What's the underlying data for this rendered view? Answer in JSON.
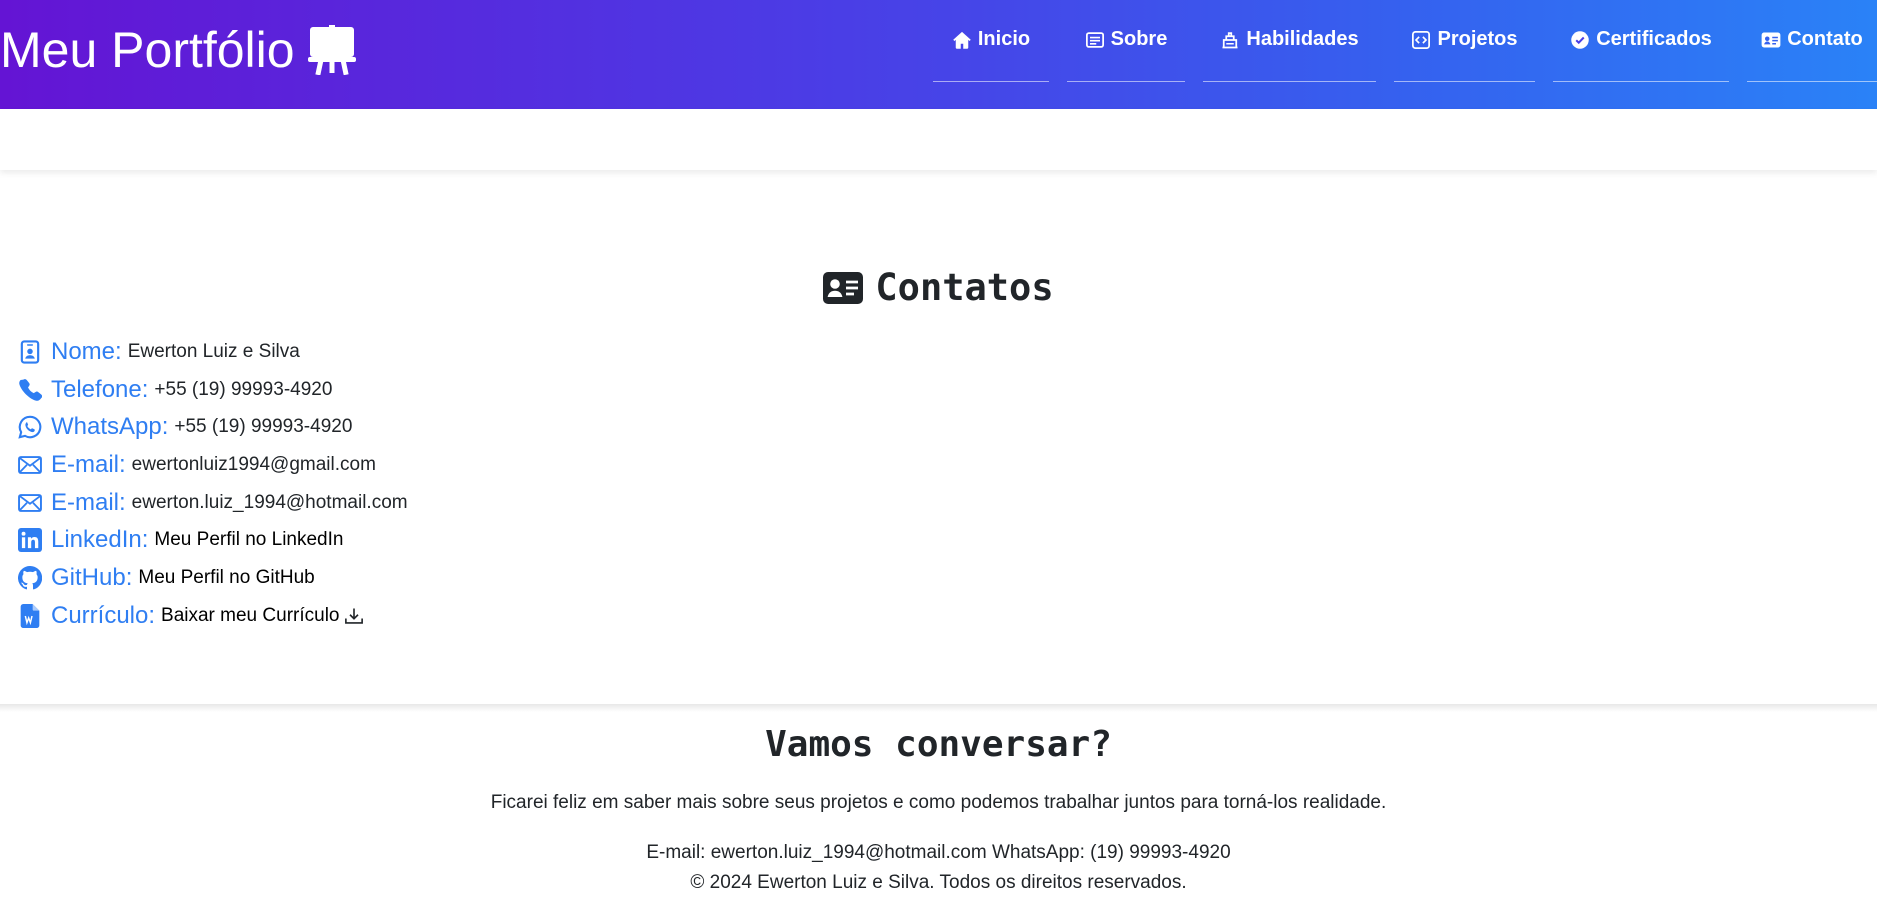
{
  "header": {
    "brand": "Meu Portfólio",
    "brand_icon": "easel-icon",
    "nav": [
      {
        "label": "Inicio",
        "icon": "house-icon"
      },
      {
        "label": "Sobre",
        "icon": "file-text-icon"
      },
      {
        "label": "Habilidades",
        "icon": "building-icon"
      },
      {
        "label": "Projetos",
        "icon": "code-square-icon"
      },
      {
        "label": "Certificados",
        "icon": "patch-check-icon"
      },
      {
        "label": "Contato",
        "icon": "person-vcard-icon"
      }
    ]
  },
  "contatos": {
    "title": "Contatos",
    "title_icon": "person-vcard-icon",
    "items": [
      {
        "label": "Nome:",
        "value": "Ewerton Luiz e Silva",
        "icon": "person-badge-icon"
      },
      {
        "label": "Telefone:",
        "value": "+55 (19) 99993-4920",
        "icon": "telephone-icon"
      },
      {
        "label": "WhatsApp:",
        "value": "+55 (19) 99993-4920",
        "icon": "whatsapp-icon"
      },
      {
        "label": "E-mail:",
        "value": "ewertonluiz1994@gmail.com",
        "icon": "envelope-icon"
      },
      {
        "label": "E-mail:",
        "value": "ewerton.luiz_1994@hotmail.com",
        "icon": "envelope-icon"
      },
      {
        "label": "LinkedIn:",
        "value": "Meu Perfil no LinkedIn",
        "icon": "linkedin-icon"
      },
      {
        "label": "GitHub:",
        "value": "Meu Perfil no GitHub",
        "icon": "github-icon"
      },
      {
        "label": "Currículo:",
        "value": "Baixar meu Currículo",
        "icon": "file-word-icon"
      }
    ]
  },
  "footer": {
    "title": "Vamos conversar?",
    "text": "Ficarei feliz em saber mais sobre seus projetos e como podemos trabalhar juntos para torná-los realidade.",
    "contact": "E-mail: ewerton.luiz_1994@hotmail.com WhatsApp: (19) 99993-4920",
    "copyright": "© 2024 Ewerton Luiz e Silva. Todos os direitos reservados."
  },
  "colors": {
    "gradient_start": "#6414d4",
    "gradient_end": "#2a82f7",
    "label_blue": "#2f7ef2",
    "text_dark": "#212529"
  }
}
